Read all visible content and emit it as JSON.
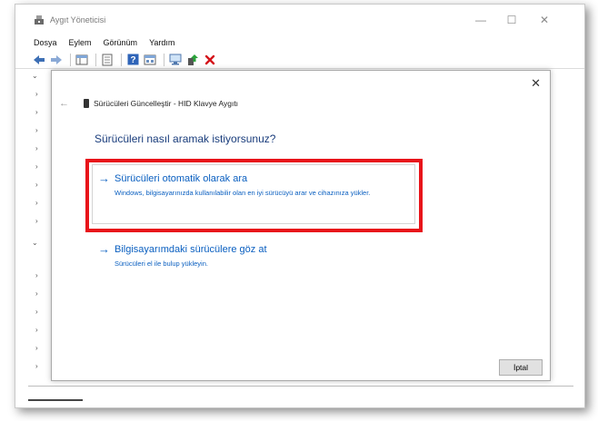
{
  "window": {
    "title": "Aygıt Yöneticisi",
    "controls": {
      "minimize": "—",
      "maximize": "☐",
      "close": "✕"
    }
  },
  "menu": [
    "Dosya",
    "Eylem",
    "Görünüm",
    "Yardım"
  ],
  "toolbar": {
    "icons": [
      "back-icon",
      "forward-icon",
      "show-hide-console-tree-icon",
      "properties-icon",
      "help-icon",
      "view-icon",
      "scan-hardware-icon",
      "update-driver-icon",
      "uninstall-device-icon"
    ]
  },
  "dialog": {
    "title": "Sürücüleri Güncelleştir - HID Klavye Aygıtı",
    "heading": "Sürücüleri nasıl aramak istiyorsunuz?",
    "options": [
      {
        "label": "Sürücüleri otomatik olarak ara",
        "description": "Windows, bilgisayarınızda kullanılabilir olan en iyi sürücüyü arar ve cihazınıza yükler."
      },
      {
        "label": "Bilgisayarımdaki sürücülere göz at",
        "description": "Sürücüleri el ile bulup yükleyin."
      }
    ],
    "cancel_label": "İptal",
    "arrow_glyph": "→",
    "close_glyph": "✕",
    "back_glyph": "←"
  },
  "colors": {
    "link_blue": "#0a5fc0",
    "heading_blue": "#1a3d7c",
    "highlight_red": "#e8141a"
  }
}
